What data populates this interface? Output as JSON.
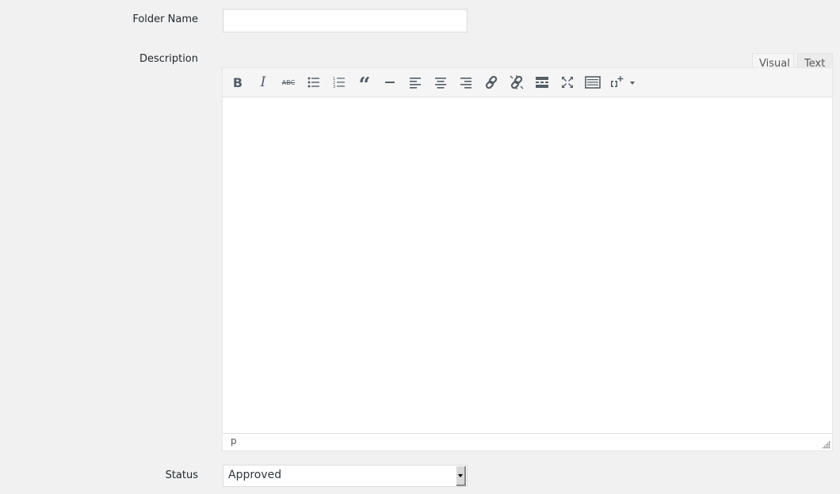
{
  "form": {
    "folder_name": {
      "label": "Folder Name",
      "value": "",
      "placeholder": ""
    },
    "description": {
      "label": "Description",
      "tabs": [
        {
          "label": "Visual",
          "active": true
        },
        {
          "label": "Text",
          "active": false
        }
      ],
      "toolbar": [
        {
          "name": "bold",
          "icon": "bold-icon"
        },
        {
          "name": "italic",
          "icon": "italic-icon"
        },
        {
          "name": "strikethrough",
          "icon": "strikethrough-icon"
        },
        {
          "name": "bulleted-list",
          "icon": "bulleted-list-icon"
        },
        {
          "name": "numbered-list",
          "icon": "numbered-list-icon"
        },
        {
          "name": "blockquote",
          "icon": "blockquote-icon"
        },
        {
          "name": "horizontal-line",
          "icon": "horizontal-line-icon"
        },
        {
          "name": "align-left",
          "icon": "align-left-icon"
        },
        {
          "name": "align-center",
          "icon": "align-center-icon"
        },
        {
          "name": "align-right",
          "icon": "align-right-icon"
        },
        {
          "name": "insert-link",
          "icon": "link-icon"
        },
        {
          "name": "remove-link",
          "icon": "unlink-icon"
        },
        {
          "name": "read-more",
          "icon": "read-more-icon"
        },
        {
          "name": "fullscreen",
          "icon": "fullscreen-icon"
        },
        {
          "name": "toolbar-toggle",
          "icon": "keyboard-icon"
        },
        {
          "name": "shortcodes",
          "icon": "shortcode-icon"
        }
      ],
      "content": "",
      "path": "p"
    },
    "status": {
      "label": "Status",
      "selected": "Approved"
    }
  }
}
